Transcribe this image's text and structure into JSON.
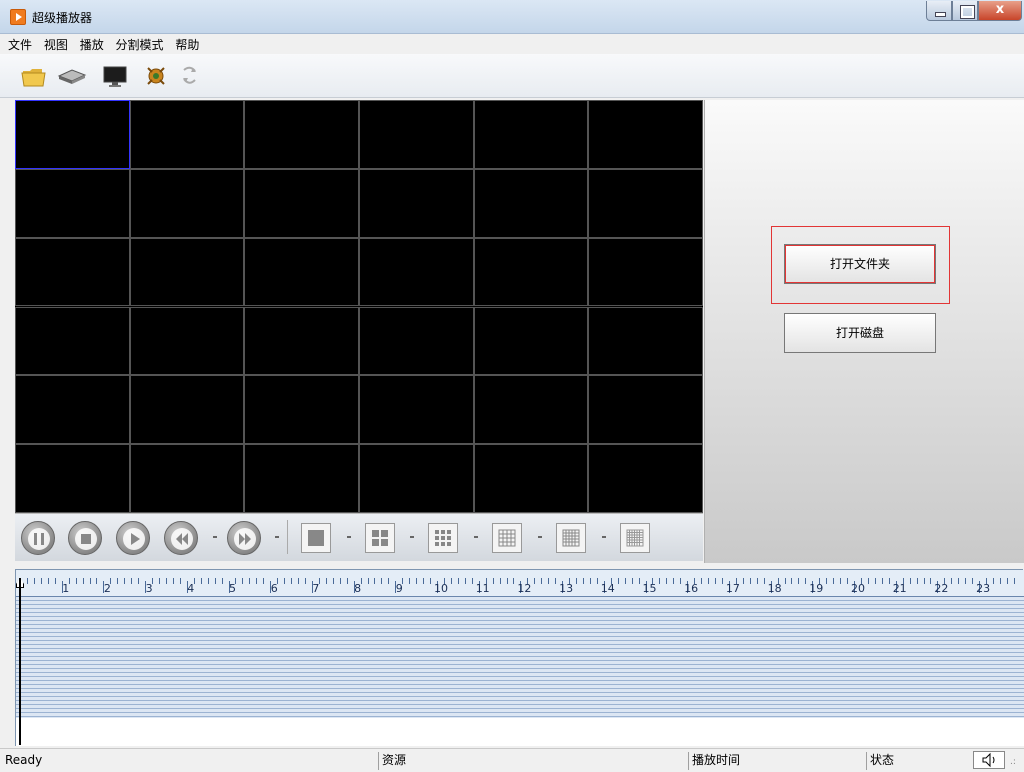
{
  "window": {
    "title": "超级播放器",
    "close_label": "x"
  },
  "menu": [
    "文件",
    "视图",
    "播放",
    "分割模式",
    "帮助"
  ],
  "toolbar": {
    "icons": [
      "folder-icon",
      "disk-drive-icon",
      "monitor-icon",
      "settings-icon",
      "refresh-icon"
    ]
  },
  "video_grid": {
    "rows": 6,
    "cols": 6,
    "active_cell": [
      0,
      0
    ]
  },
  "controls": {
    "buttons": [
      "pause-icon",
      "stop-icon",
      "play-icon",
      "rewind-icon",
      "fast-forward-icon"
    ],
    "layouts": [
      "1x1",
      "2x2",
      "3x3",
      "4x4",
      "5x5",
      "6x6"
    ]
  },
  "right_panel": {
    "open_folder_label": "打开文件夹",
    "open_disk_label": "打开磁盘"
  },
  "timeline": {
    "hours": [
      "1",
      "2",
      "3",
      "4",
      "5",
      "6",
      "7",
      "8",
      "9",
      "10",
      "11",
      "12",
      "13",
      "14",
      "15",
      "16",
      "17",
      "18",
      "19",
      "20",
      "21",
      "22",
      "23"
    ]
  },
  "status": {
    "ready": "Ready",
    "resource": "资源",
    "play_time": "播放时间",
    "state": "状态"
  },
  "colors": {
    "accent": "#e23535",
    "timeline_bg": "#d8e4f2"
  }
}
